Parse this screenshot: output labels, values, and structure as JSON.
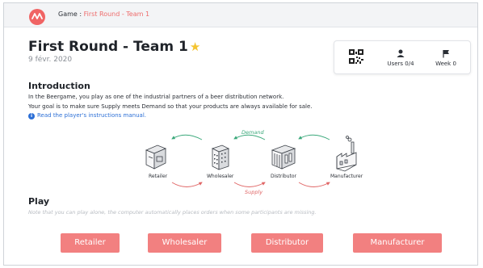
{
  "breadcrumb": {
    "prefix": "Game :",
    "current": "First Round - Team 1"
  },
  "game": {
    "title": "First Round - Team 1",
    "date": "9 févr. 2020"
  },
  "stats": {
    "users": "Users 0/4",
    "week": "Week 0"
  },
  "intro": {
    "heading": "Introduction",
    "line1": "In the Beergame, you play as one of the industrial partners of a beer distribution network.",
    "line2": "Your goal is to make sure Supply meets Demand so that your products are always available for sale.",
    "manual_link": "Read the player's instructions manual."
  },
  "diagram": {
    "nodes": [
      "Retailer",
      "Wholesaler",
      "Distributor",
      "Manufacturer"
    ],
    "demand_label": "Demand",
    "supply_label": "Supply",
    "demand_color": "#3aa87a",
    "supply_color": "#e06666"
  },
  "play": {
    "heading": "Play",
    "note": "Note that you can play alone, the computer automatically places orders when some participants are missing."
  },
  "roles": [
    "Retailer",
    "Wholesaler",
    "Distributor",
    "Manufacturer"
  ],
  "colors": {
    "accent": "#f28080",
    "logo": "#f06464",
    "link": "#2c6fd6",
    "star": "#f4c430"
  },
  "icons": {
    "logo": "app-logo-icon",
    "star": "star-icon",
    "qr": "qr-code-icon",
    "users": "user-icon",
    "week": "flag-icon",
    "info": "info-icon"
  }
}
